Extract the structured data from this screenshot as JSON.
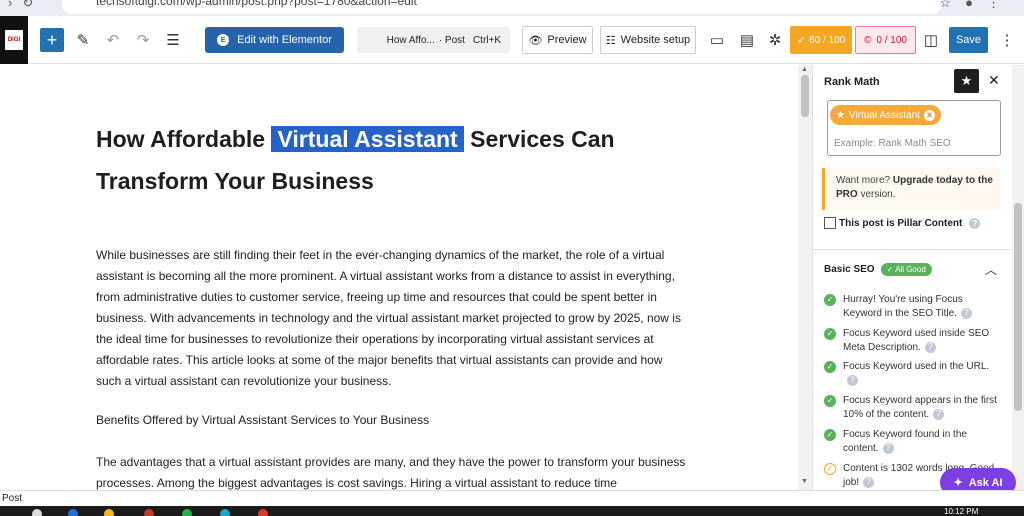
{
  "browser": {
    "url": "techsoftdigi.com/wp-admin/post.php?post=1780&action=edit"
  },
  "toolbar": {
    "site_badge": "DIGI",
    "add_icon": "+",
    "elementor_label": "Edit with Elementor",
    "command_title": "How Affo...",
    "command_type": "· Post",
    "command_shortcut": "Ctrl+K",
    "preview_label": "Preview",
    "website_setup_label": "Website setup",
    "seo_score": "60 / 100",
    "readability_score": "0 / 100",
    "save_label": "Save"
  },
  "post": {
    "title_before": "How Affordable",
    "title_highlight": "Virtual Assistant",
    "title_after": "Services Can Transform Your Business",
    "para1": "While businesses are still finding their feet in the ever-changing dynamics of the market, the role of a virtual assistant is becoming all the more prominent. A virtual assistant works from a distance to assist in everything, from administrative duties to customer service, freeing up time and resources that could be spent better in business. With advancements in technology and the virtual assistant market projected to grow by 2025, now is the ideal time for businesses to revolutionize their operations by incorporating virtual assistant services at affordable rates. This article looks at some of the major benefits that virtual assistants can provide and how such a virtual assistant can revolutionize your business.",
    "para2": "Benefits Offered by Virtual Assistant Services to Your Business",
    "para3": "The advantages that a virtual assistant provides are many, and they have the power to transform your business processes. Among the biggest advantages is cost savings. Hiring a virtual assistant to reduce time"
  },
  "sidebar": {
    "title": "Rank Math",
    "focus_keyword": "Virtual Assistant",
    "keyword_placeholder": "Example: Rank Math SEO",
    "upgrade_prefix": "Want more?",
    "upgrade_link": "Upgrade today to the PRO",
    "upgrade_suffix": "version.",
    "pillar_label": "This post is Pillar Content",
    "basic_seo_label": "Basic SEO",
    "basic_seo_badge": "✓ All Good",
    "checks": [
      {
        "text": "Hurray! You're using Focus Keyword in the SEO Title.",
        "status": "good"
      },
      {
        "text": "Focus Keyword used inside SEO Meta Description.",
        "status": "good"
      },
      {
        "text": "Focus Keyword used in the URL.",
        "status": "good"
      },
      {
        "text": "Focus Keyword appears in the first 10% of the content.",
        "status": "good"
      },
      {
        "text": "Focus Keyword found in the content.",
        "status": "good"
      },
      {
        "text": "Content is 1302 words long. Good job!",
        "status": "warn"
      }
    ]
  },
  "ask_ai_label": "Ask AI",
  "status_bar": "Post",
  "taskbar_time": "10:12 PM",
  "colors": {
    "accent_blue": "#2271b1",
    "seo_orange": "#f5a623",
    "readability_pink": "#d0104c",
    "good_green": "#59b15c",
    "ai_purple": "#7b3fe4"
  }
}
